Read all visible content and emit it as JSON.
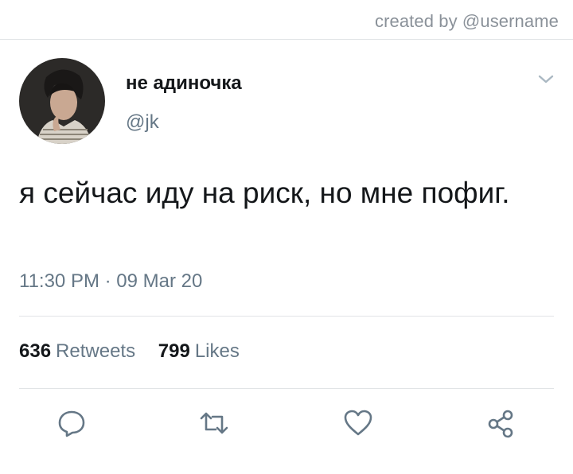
{
  "header": {
    "created_by": "created by @username"
  },
  "tweet": {
    "display_name": "не адиночка",
    "handle": "@jk",
    "text": "я сейчас иду на риск, но мне пофиг.",
    "timestamp": "11:30 PM · 09 Mar 20",
    "retweets": {
      "count": "636",
      "label": "Retweets"
    },
    "likes": {
      "count": "799",
      "label": "Likes"
    }
  },
  "icons": {
    "caret": "chevron-down-icon",
    "reply": "reply-icon",
    "retweet": "retweet-icon",
    "like": "heart-icon",
    "share": "share-icon"
  },
  "colors": {
    "text": "#14171a",
    "secondary": "#657786",
    "icon": "#657786",
    "divider": "#e1e4e6"
  }
}
